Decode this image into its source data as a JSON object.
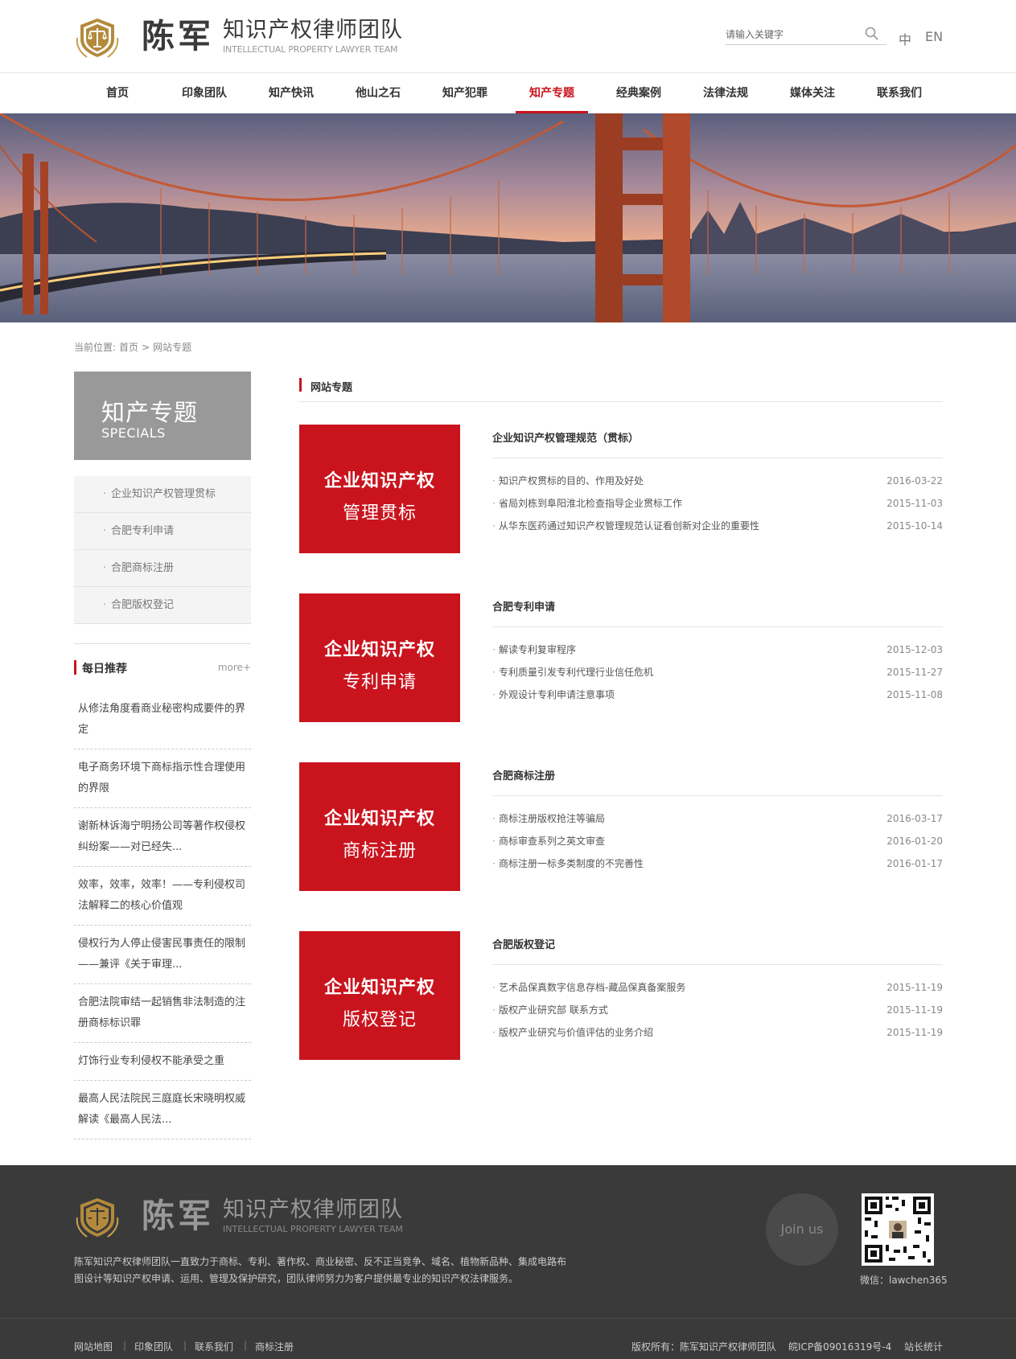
{
  "header": {
    "brand_name": "陈军",
    "brand_title": "知识产权律师团队",
    "brand_sub": "INTELLECTUAL PROPERTY LAWYER TEAM",
    "search_placeholder": "请输入关键字",
    "lang_zh": "中",
    "lang_en": "EN"
  },
  "nav": {
    "items": [
      "首页",
      "印象团队",
      "知产快讯",
      "他山之石",
      "知产犯罪",
      "知产专题",
      "经典案例",
      "法律法规",
      "媒体关注",
      "联系我们"
    ],
    "active": "知产专题"
  },
  "breadcrumb": {
    "prefix": "当前位置:",
    "home": "首页",
    "sep": ">",
    "current": "网站专题"
  },
  "sidebar": {
    "title_cn": "知产专题",
    "title_en": "SPECIALS",
    "menu": [
      "企业知识产权管理贯标",
      "合肥专利申请",
      "合肥商标注册",
      "合肥版权登记"
    ],
    "recommend_title": "每日推荐",
    "recommend_more": "more+",
    "recommend": [
      "从修法角度看商业秘密构成要件的界定",
      "电子商务环境下商标指示性合理使用的界限",
      "谢新林诉海宁明扬公司等著作权侵权纠纷案——对已经失...",
      "效率，效率，效率！——专利侵权司法解释二的核心价值观",
      "侵权行为人停止侵害民事责任的限制——兼评《关于审理...",
      "合肥法院审结一起销售非法制造的注册商标标识罪",
      "灯饰行业专利侵权不能承受之重",
      "最高人民法院民三庭庭长宋晓明权威解读《最高人民法..."
    ]
  },
  "main": {
    "title": "网站专题",
    "topics": [
      {
        "card_line1": "企业知识产权",
        "card_line2": "管理贯标",
        "title": "企业知识产权管理规范（贯标）",
        "items": [
          {
            "text": "知识产权贯标的目的、作用及好处",
            "date": "2016-03-22"
          },
          {
            "text": "省局刘栋到阜阳淮北检查指导企业贯标工作",
            "date": "2015-11-03"
          },
          {
            "text": "从华东医药通过知识产权管理规范认证看创新对企业的重要性",
            "date": "2015-10-14"
          }
        ]
      },
      {
        "card_line1": "企业知识产权",
        "card_line2": "专利申请",
        "title": "合肥专利申请",
        "items": [
          {
            "text": "解读专利复审程序",
            "date": "2015-12-03"
          },
          {
            "text": "专利质量引发专利代理行业信任危机",
            "date": "2015-11-27"
          },
          {
            "text": "外观设计专利申请注意事项",
            "date": "2015-11-08"
          }
        ]
      },
      {
        "card_line1": "企业知识产权",
        "card_line2": "商标注册",
        "title": "合肥商标注册",
        "items": [
          {
            "text": "商标注册版权抢注等骗局",
            "date": "2016-03-17"
          },
          {
            "text": "商标审查系列之英文审查",
            "date": "2016-01-20"
          },
          {
            "text": "商标注册一标多类制度的不完善性",
            "date": "2016-01-17"
          }
        ]
      },
      {
        "card_line1": "企业知识产权",
        "card_line2": "版权登记",
        "title": "合肥版权登记",
        "items": [
          {
            "text": "艺术品保真数字信息存档-藏品保真备案服务",
            "date": "2015-11-19"
          },
          {
            "text": "版权产业研究部 联系方式",
            "date": "2015-11-19"
          },
          {
            "text": "版权产业研究与价值评估的业务介绍",
            "date": "2015-11-19"
          }
        ]
      }
    ]
  },
  "footer": {
    "brand_name": "陈军",
    "brand_title": "知识产权律师团队",
    "brand_sub": "INTELLECTUAL PROPERTY LAWYER TEAM",
    "description": "陈军知识产权律师团队一直致力于商标、专利、著作权、商业秘密、反不正当竞争、域名、植物新品种、集成电路布图设计等知识产权申请、运用、管理及保护研究，团队律师努力为客户提供最专业的知识产权法律服务。",
    "join": "Join us",
    "wechat": "微信：lawchen365",
    "links": [
      "网站地图",
      "印象团队",
      "联系我们",
      "商标注册"
    ],
    "copyright": "版权所有：陈军知识产权律师团队",
    "icp": "皖ICP备09016319号-4",
    "stats": "站长统计"
  },
  "colors": {
    "accent": "#c9141e",
    "footer_bg": "#3a3a3a",
    "sidebar_head": "#999999"
  }
}
